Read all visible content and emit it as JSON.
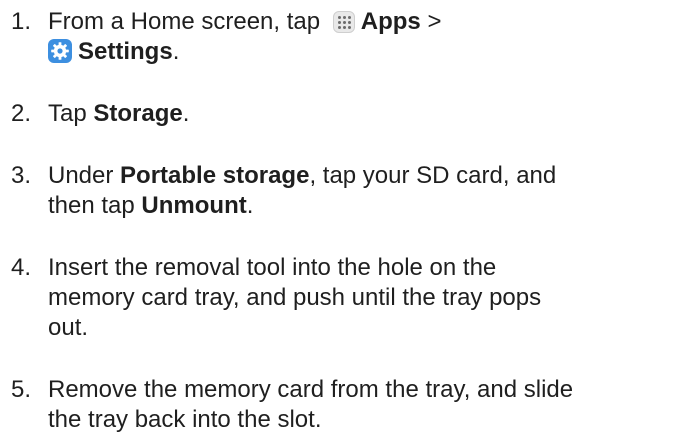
{
  "steps": [
    {
      "number": "1.",
      "line1_pre": "From a Home screen, tap",
      "apps_icon": "apps-grid-icon",
      "apps_label": "Apps",
      "separator": ">",
      "settings_icon": "settings-gear-icon",
      "settings_label": "Settings",
      "line2_post": "."
    },
    {
      "number": "2.",
      "pre": "Tap",
      "bold": "Storage",
      "post": "."
    },
    {
      "number": "3.",
      "pre": "Under",
      "bold1": "Portable storage",
      "mid": ", tap your SD card, and",
      "line2_pre": "then tap",
      "bold2": "Unmount",
      "post": "."
    },
    {
      "number": "4.",
      "line1": "Insert the removal tool into the hole on the",
      "line2": "memory card tray, and push until the tray pops",
      "line3": "out."
    },
    {
      "number": "5.",
      "line1": "Remove the memory card from the tray, and slide",
      "line2": "the tray back into the slot."
    }
  ],
  "colors": {
    "text": "#1f1f1f",
    "settings_icon_bg": "#3d8fe0",
    "apps_icon_bg": "#e9e9e9"
  }
}
